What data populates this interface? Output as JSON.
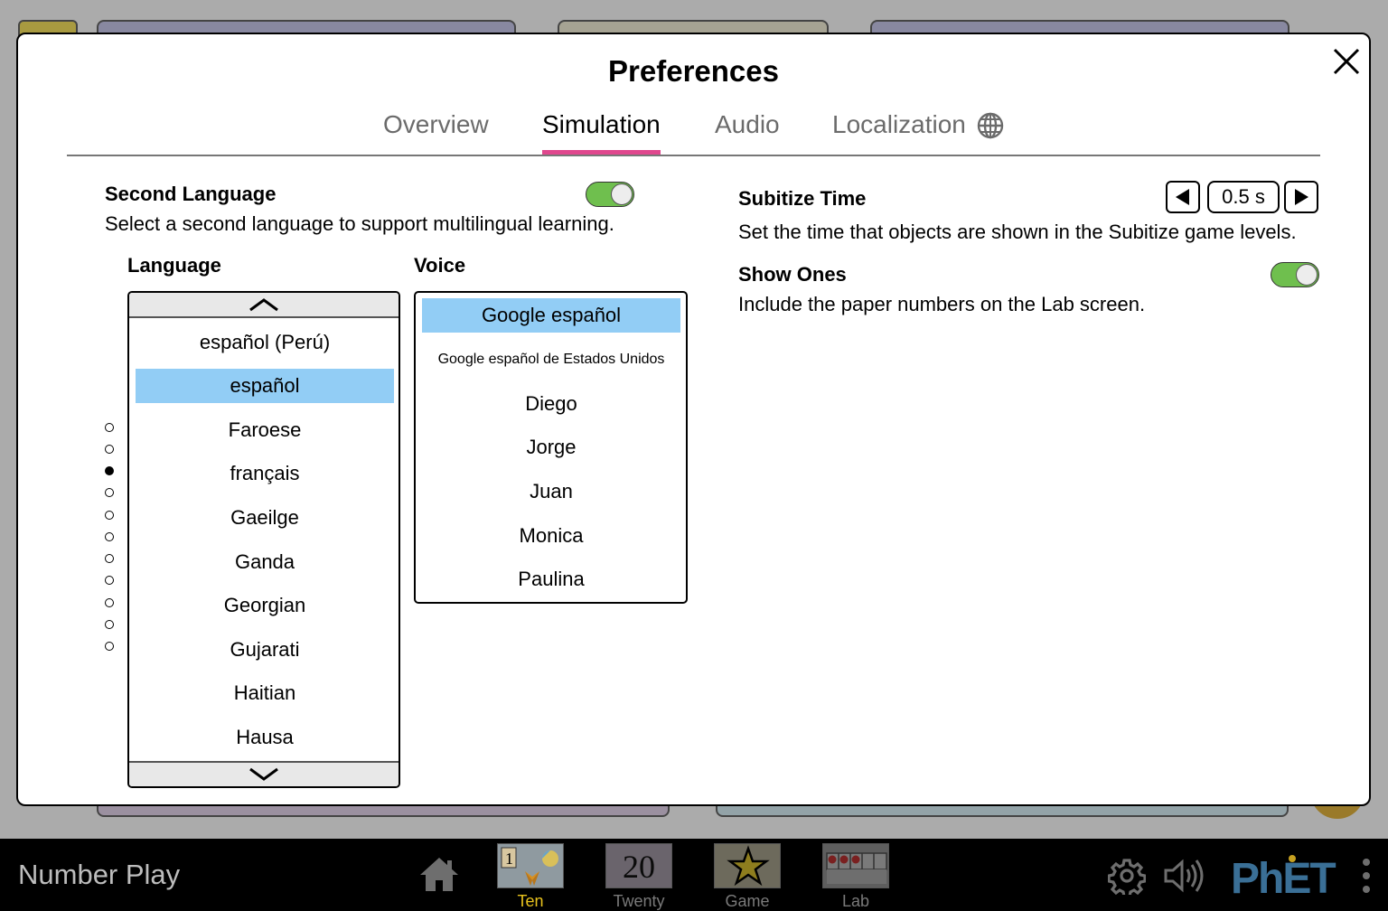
{
  "dialog": {
    "title": "Preferences",
    "tabs": [
      "Overview",
      "Simulation",
      "Audio",
      "Localization"
    ],
    "active_tab": "Simulation"
  },
  "second_language": {
    "title": "Second Language",
    "description": "Select a second language to support multilingual learning.",
    "enabled": true,
    "language_header": "Language",
    "voice_header": "Voice",
    "languages": [
      "español (Perú)",
      "español",
      "Faroese",
      "français",
      "Gaeilge",
      "Ganda",
      "Georgian",
      "Gujarati",
      "Haitian",
      "Hausa"
    ],
    "selected_language": "español",
    "voices": [
      "Google español",
      "Google español de Estados Unidos",
      "Diego",
      "Jorge",
      "Juan",
      "Monica",
      "Paulina"
    ],
    "selected_voice": "Google español",
    "page_dots_count": 11,
    "page_dot_active_index": 2
  },
  "subitize_time": {
    "title": "Subitize Time",
    "value": "0.5 s",
    "description": "Set the time that objects are shown in the Subitize game levels."
  },
  "show_ones": {
    "title": "Show Ones",
    "description": "Include the paper numbers on the Lab screen.",
    "enabled": true
  },
  "navbar": {
    "sim_title": "Number Play",
    "screens": [
      "Ten",
      "Twenty",
      "Game",
      "Lab"
    ],
    "active_screen": "Ten",
    "twenty_thumb_text": "20",
    "ten_thumb_text": "1"
  },
  "icons": {
    "close": "close-icon",
    "globe": "globe-icon",
    "home": "home-icon",
    "settings": "gear-icon",
    "audio": "speaker-icon",
    "menu": "kebab-menu-icon"
  },
  "colors": {
    "accent_tab": "#e0478e",
    "selected_item": "#92cdf5",
    "toggle_on": "#6fbf4e",
    "active_screen_label": "#e8c21d"
  }
}
